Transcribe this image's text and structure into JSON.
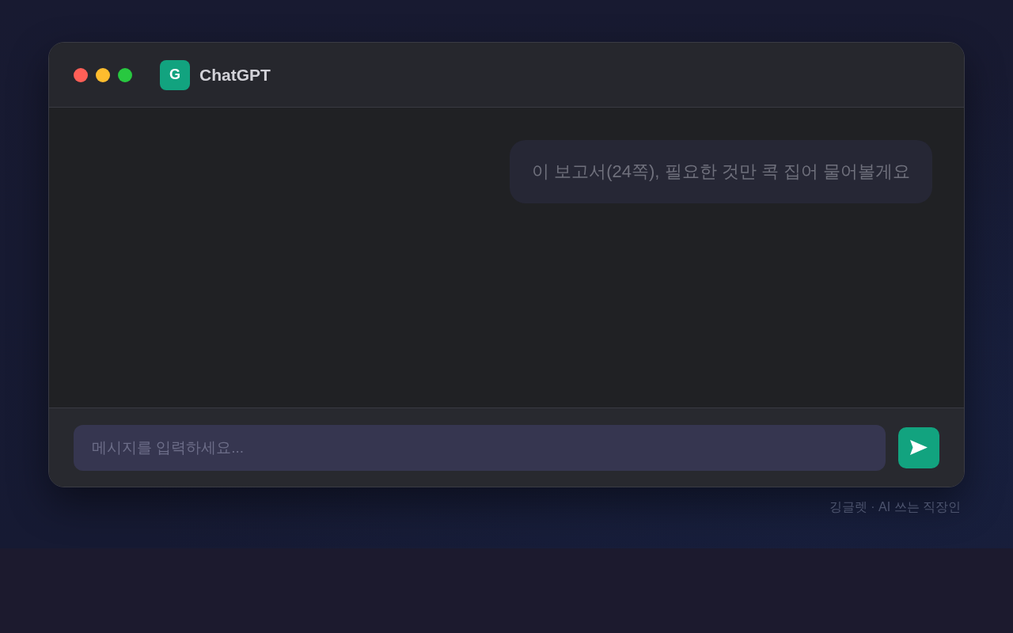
{
  "window": {
    "logo": {
      "letter": "G"
    },
    "title": "ChatGPT"
  },
  "messages": [
    {
      "kind": "user",
      "text": "이 보고서(24쪽), 필요한 것만 콕 집어 물어볼게요"
    }
  ],
  "composer": {
    "placeholder": "메시지를 입력하세요..."
  },
  "credit": "깅글렛 · AI 쓰는 직장인"
}
